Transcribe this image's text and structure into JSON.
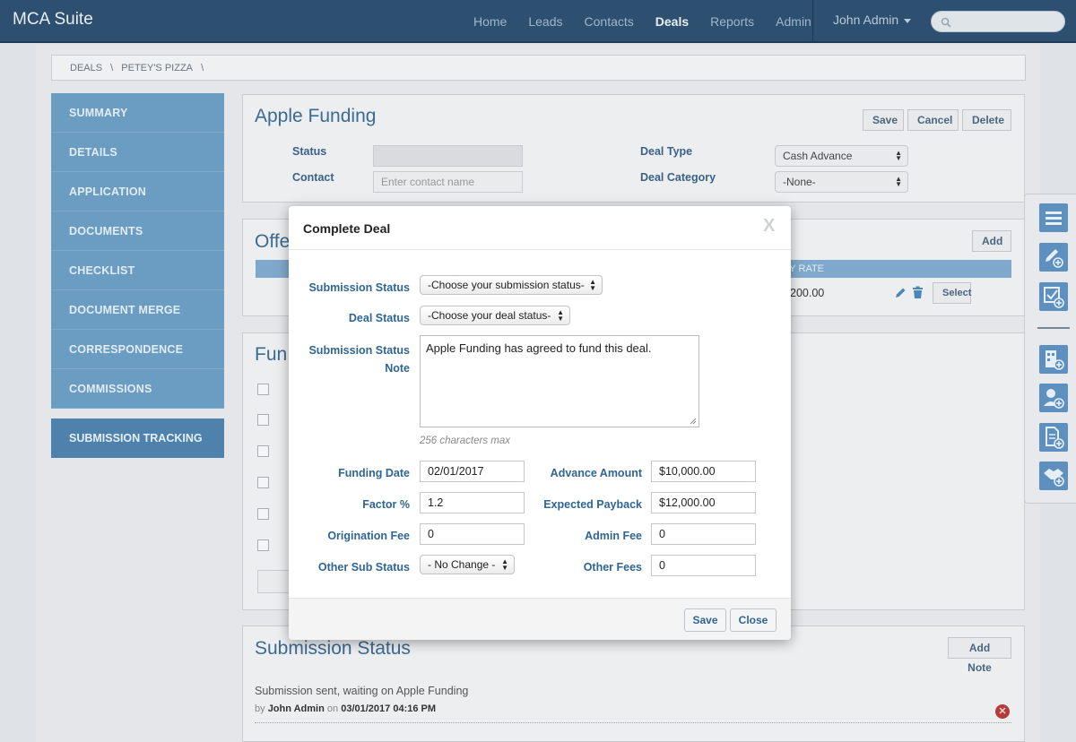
{
  "app": {
    "brand": "MCA Suite",
    "nav": [
      "Home",
      "Leads",
      "Contacts",
      "Deals",
      "Reports",
      "Admin"
    ],
    "nav_active": "Deals",
    "user": "John Admin"
  },
  "breadcrumb": [
    "DEALS",
    "\\",
    "PETEY'S PIZZA",
    "\\"
  ],
  "sidebar": {
    "items": [
      "SUMMARY",
      "DETAILS",
      "APPLICATION",
      "DOCUMENTS",
      "CHECKLIST",
      "DOCUMENT MERGE",
      "CORRESPONDENCE",
      "COMMISSIONS"
    ],
    "tracking": "SUBMISSION TRACKING"
  },
  "deal_panel": {
    "title": "Apple Funding",
    "save": "Save",
    "cancel": "Cancel",
    "delete": "Delete",
    "status_label": "Status",
    "contact_label": "Contact",
    "contact_placeholder": "Enter contact name",
    "deal_type_label": "Deal Type",
    "deal_type_value": "Cash Advance",
    "deal_category_label": "Deal Category",
    "deal_category_value": "-None-"
  },
  "offers_panel": {
    "title_partial": "Offe",
    "add": "Add",
    "col_partial": "LY RATE",
    "row_value_partial": "200.00",
    "select": "Select"
  },
  "funding_panel": {
    "title_partial": "Fun"
  },
  "modal": {
    "title": "Complete Deal",
    "close": "X",
    "submission_status_label": "Submission Status",
    "submission_status_value": "-Choose your submission status-",
    "deal_status_label": "Deal Status",
    "deal_status_value": "-Choose your deal status-",
    "note_label_1": "Submission Status",
    "note_label_2": "Note",
    "note_value": "Apple Funding has agreed to fund this deal.",
    "note_hint": "256 characters max",
    "funding_date_label": "Funding Date",
    "funding_date_value": "02/01/2017",
    "factor_label": "Factor %",
    "factor_value": "1.2",
    "origination_fee_label": "Origination Fee",
    "origination_fee_value": "0",
    "other_sub_status_label": "Other Sub Status",
    "other_sub_status_value": "- No Change -",
    "advance_amount_label": "Advance Amount",
    "advance_amount_value": "$10,000.00",
    "expected_payback_label": "Expected Payback",
    "expected_payback_value": "$12,000.00",
    "admin_fee_label": "Admin Fee",
    "admin_fee_value": "0",
    "other_fees_label": "Other Fees",
    "other_fees_value": "0",
    "save": "Save",
    "close_button": "Close"
  },
  "submission_panel": {
    "title": "Submission Status",
    "add_note": "Add Note",
    "message": "Submission sent, waiting on Apple Funding",
    "by": "by",
    "author": "John Admin",
    "on": "on",
    "timestamp": "03/01/2017 04:16 PM"
  },
  "icons": {
    "toolbar": [
      "list-icon",
      "edit-add-icon",
      "checklist-add-icon",
      "building-add-icon",
      "user-add-icon",
      "document-add-icon",
      "handshake-add-icon"
    ]
  },
  "colors": {
    "nav_bg": "#2d4f70",
    "sidebar_bg": "#6b9cc2",
    "accent": "#2f6593",
    "delete_icon": "#b63b3b"
  }
}
